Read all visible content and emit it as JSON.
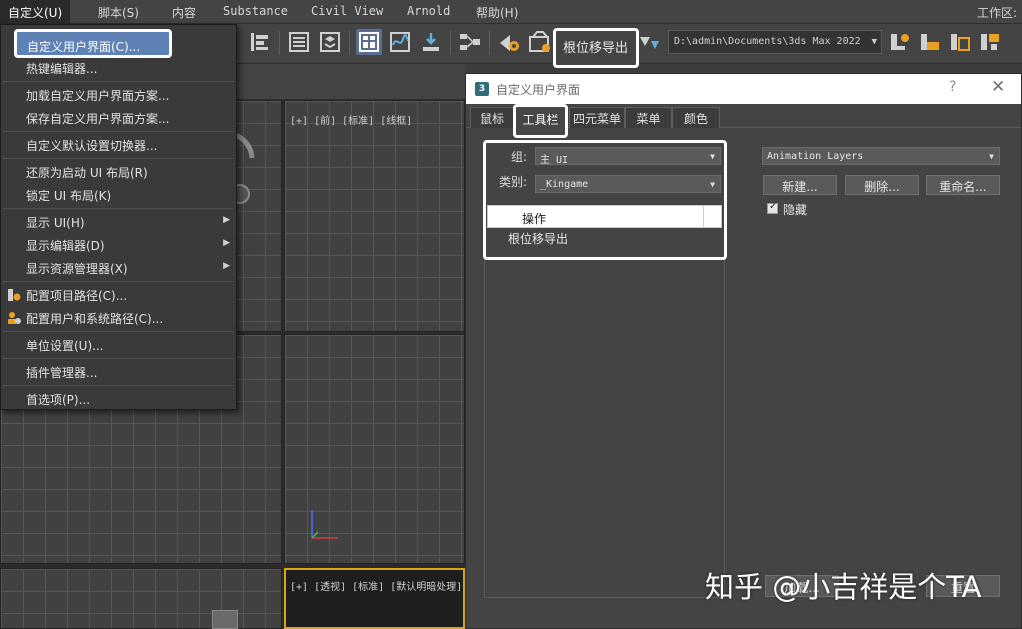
{
  "menubar": {
    "items": [
      {
        "label": "自定义(U)"
      },
      {
        "label": "脚本(S)"
      },
      {
        "label": "内容"
      },
      {
        "label": "Substance"
      },
      {
        "label": "Civil View"
      },
      {
        "label": "Arnold"
      },
      {
        "label": "帮助(H)"
      }
    ],
    "workspace_label": "工作区:"
  },
  "toolbar": {
    "custom_toolbar_label": "根位移导出",
    "path_value": "D:\\admin\\Documents\\3ds Max 2022"
  },
  "dropdown": {
    "items": [
      {
        "label": "自定义用户界面(C)..."
      },
      {
        "label": "热键编辑器..."
      },
      {
        "label": "加载自定义用户界面方案..."
      },
      {
        "label": "保存自定义用户界面方案..."
      },
      {
        "label": "自定义默认设置切换器..."
      },
      {
        "label": "还原为启动 UI 布局(R)"
      },
      {
        "label": "锁定 UI 布局(K)"
      },
      {
        "label": "显示 UI(H)"
      },
      {
        "label": "显示编辑器(D)"
      },
      {
        "label": "显示资源管理器(X)"
      },
      {
        "label": "配置项目路径(C)..."
      },
      {
        "label": "配置用户和系统路径(C)..."
      },
      {
        "label": "单位设置(U)..."
      },
      {
        "label": "插件管理器..."
      },
      {
        "label": "首选项(P)..."
      }
    ]
  },
  "viewports": {
    "top_right_label": "[+] [前] [标准] [线框]",
    "bottom_right_label": "[+] [透视] [标准] [默认明暗处理]"
  },
  "dialog": {
    "title": "自定义用户界面",
    "help": "?",
    "close": "✕",
    "tabs": [
      {
        "label": "鼠标"
      },
      {
        "label": "工具栏"
      },
      {
        "label": "四元菜单"
      },
      {
        "label": "菜单"
      },
      {
        "label": "颜色"
      }
    ],
    "group_label": "组:",
    "group_value": "主 UI",
    "category_label": "类别:",
    "category_value": "_Kingame",
    "list_header": "操作",
    "list_items": [
      "根位移导出"
    ],
    "toolbar_combo_value": "Animation Layers",
    "buttons": {
      "new": "新建...",
      "delete": "删除...",
      "rename": "重命名..."
    },
    "hide_label": "隐藏",
    "hide_checked": true,
    "bottom_buttons": {
      "load": "加载...",
      "reset": "重置"
    }
  },
  "watermark": "知乎 @小吉祥是个TA"
}
